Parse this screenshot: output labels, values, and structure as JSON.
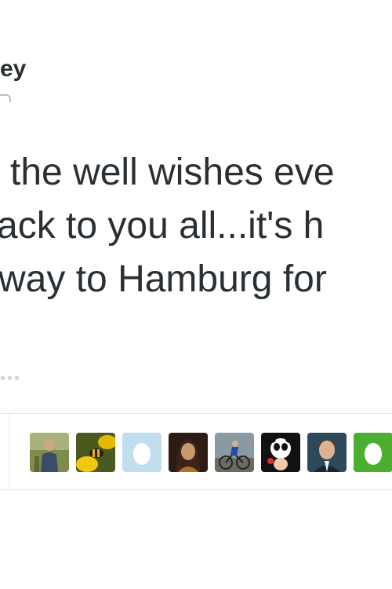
{
  "tweet": {
    "author_name_fragment": "ey",
    "text_lines": [
      "the well wishes eve",
      "ack to you all...it's h",
      "way to Hamburg for"
    ],
    "more_indicator": "•••"
  },
  "favoriters": [
    {
      "icon": "person-avatar"
    },
    {
      "icon": "bee-flower-avatar"
    },
    {
      "icon": "default-egg-avatar"
    },
    {
      "icon": "woman-avatar"
    },
    {
      "icon": "cyclist-avatar"
    },
    {
      "icon": "panda-avatar"
    },
    {
      "icon": "man-avatar"
    },
    {
      "icon": "default-egg-avatar"
    }
  ],
  "colors": {
    "text": "#292f33",
    "divider": "#e1e8ed",
    "egg_blue": "#c0deed",
    "egg_green": "#4caf2f"
  }
}
